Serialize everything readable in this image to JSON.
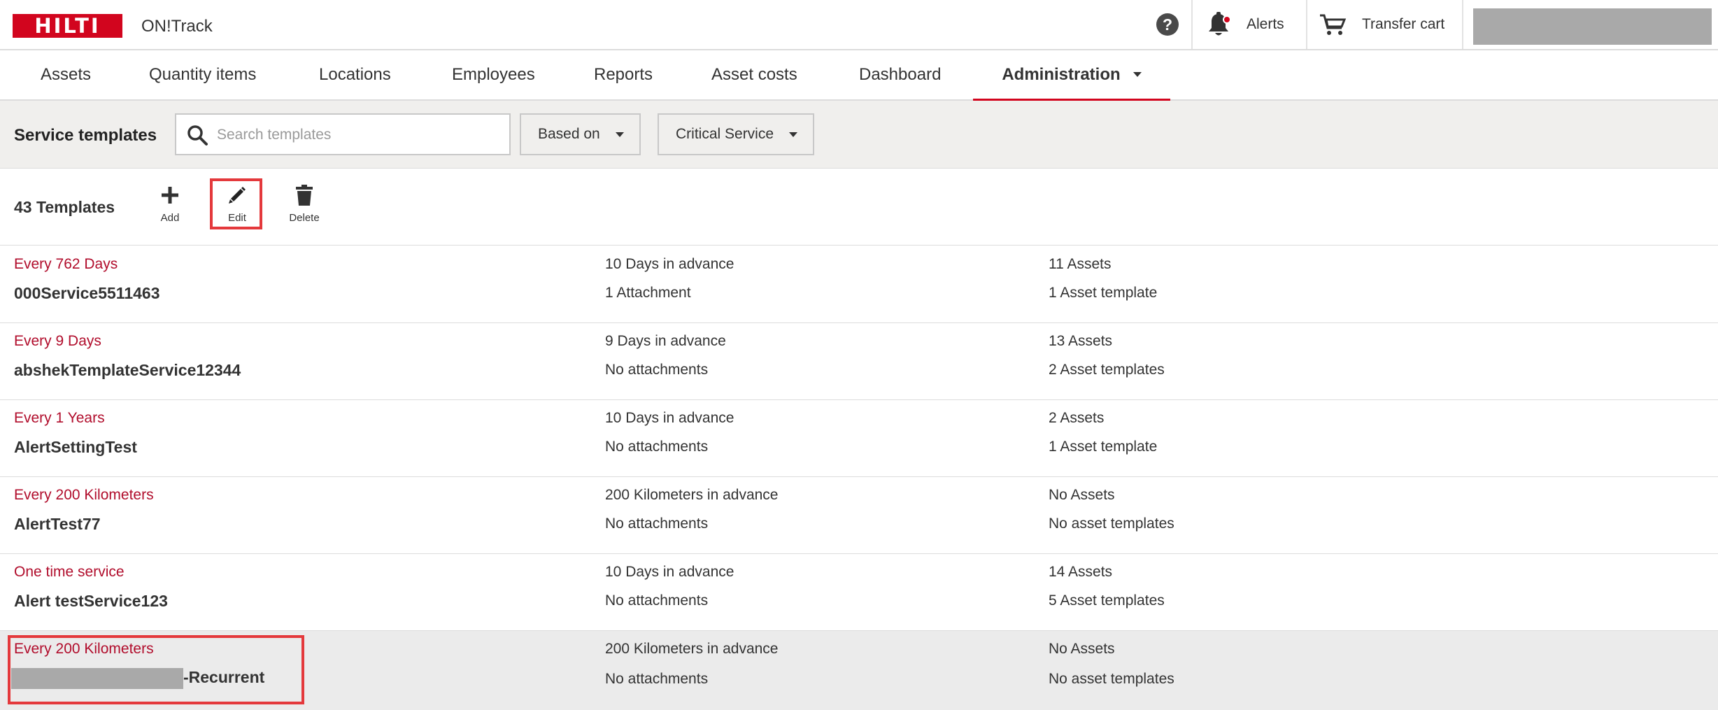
{
  "header": {
    "logo_text": "HILTI",
    "app_name": "ON!Track",
    "help_glyph": "?",
    "alerts_label": "Alerts",
    "cart_label": "Transfer cart"
  },
  "nav": {
    "tabs": [
      {
        "label": "Assets"
      },
      {
        "label": "Quantity items"
      },
      {
        "label": "Locations"
      },
      {
        "label": "Employees"
      },
      {
        "label": "Reports"
      },
      {
        "label": "Asset costs"
      },
      {
        "label": "Dashboard"
      },
      {
        "label": "Administration",
        "active": true
      }
    ]
  },
  "filters": {
    "title": "Service templates",
    "search_placeholder": "Search templates",
    "based_on_label": "Based on",
    "critical_label": "Critical Service"
  },
  "toolbar": {
    "count_label": "43 Templates",
    "add_label": "Add",
    "edit_label": "Edit",
    "delete_label": "Delete"
  },
  "rows": [
    {
      "interval": "Every 762 Days",
      "name": "000Service5511463",
      "advance": "10 Days in advance",
      "attachments": "1 Attachment",
      "assets": "11 Assets",
      "templates": "1 Asset template"
    },
    {
      "interval": "Every 9 Days",
      "name": "abshekTemplateService12344",
      "advance": "9 Days in advance",
      "attachments": "No attachments",
      "assets": "13 Assets",
      "templates": "2 Asset templates"
    },
    {
      "interval": "Every 1 Years",
      "name": "AlertSettingTest",
      "advance": "10 Days in advance",
      "attachments": "No attachments",
      "assets": "2 Assets",
      "templates": "1 Asset template"
    },
    {
      "interval": "Every 200 Kilometers",
      "name": "AlertTest77",
      "advance": "200 Kilometers in advance",
      "attachments": "No attachments",
      "assets": "No Assets",
      "templates": "No asset templates"
    },
    {
      "interval": "One time service",
      "name": "Alert testService123",
      "advance": "10 Days in advance",
      "attachments": "No attachments",
      "assets": "14 Assets",
      "templates": "5 Asset templates"
    },
    {
      "interval": "Every 200 Kilometers",
      "name": "-Recurrent",
      "advance": "200 Kilometers in advance",
      "attachments": "No attachments",
      "assets": "No Assets",
      "templates": "No asset templates",
      "selected": true
    }
  ],
  "colors": {
    "brand_red": "#d2051e",
    "interval_text": "#b10d2c",
    "highlight_box": "#e4393c"
  },
  "icons": [
    "logo",
    "help-icon",
    "bell-icon",
    "cart-icon",
    "search-icon",
    "chevron-down-icon",
    "plus-icon",
    "pencil-icon",
    "trash-icon"
  ]
}
